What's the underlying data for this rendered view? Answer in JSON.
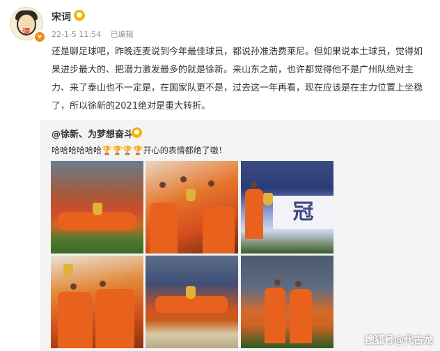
{
  "post": {
    "username": "宋词",
    "timestamp": "22-1-5 11:54",
    "edited_label": "已编辑",
    "text": "还是聊足球吧，昨晚连麦说到今年最佳球员，都说孙准浩费莱尼。但如果说本土球员，觉得如果进步最大的、把潜力激发最多的就是徐新。来山东之前，也许都觉得他不是广州队绝对主力、来了泰山也不一定是，在国家队更不是，过去这一年再看，现在应该是在主力位置上坐稳了，所以徐新的2021绝对是重大转折。"
  },
  "repost": {
    "author": "@徐新、为梦想奋斗",
    "text_prefix": "哈哈哈哈哈哈",
    "text_suffix": "开心的表情都绝了嗷！",
    "trophies": "🏆🏆🏆🏆",
    "photo_banner_text": "冠"
  },
  "watermark": "搜狐号@代古龙",
  "colors": {
    "meta_gray": "#939393",
    "repost_bg": "#f4f4f4",
    "verified_orange": "#f08a1c",
    "team_orange": "#e8621e"
  },
  "icons": {
    "verified": "v-badge-icon",
    "member": "member-badge-icon",
    "trophy": "trophy-icon"
  }
}
